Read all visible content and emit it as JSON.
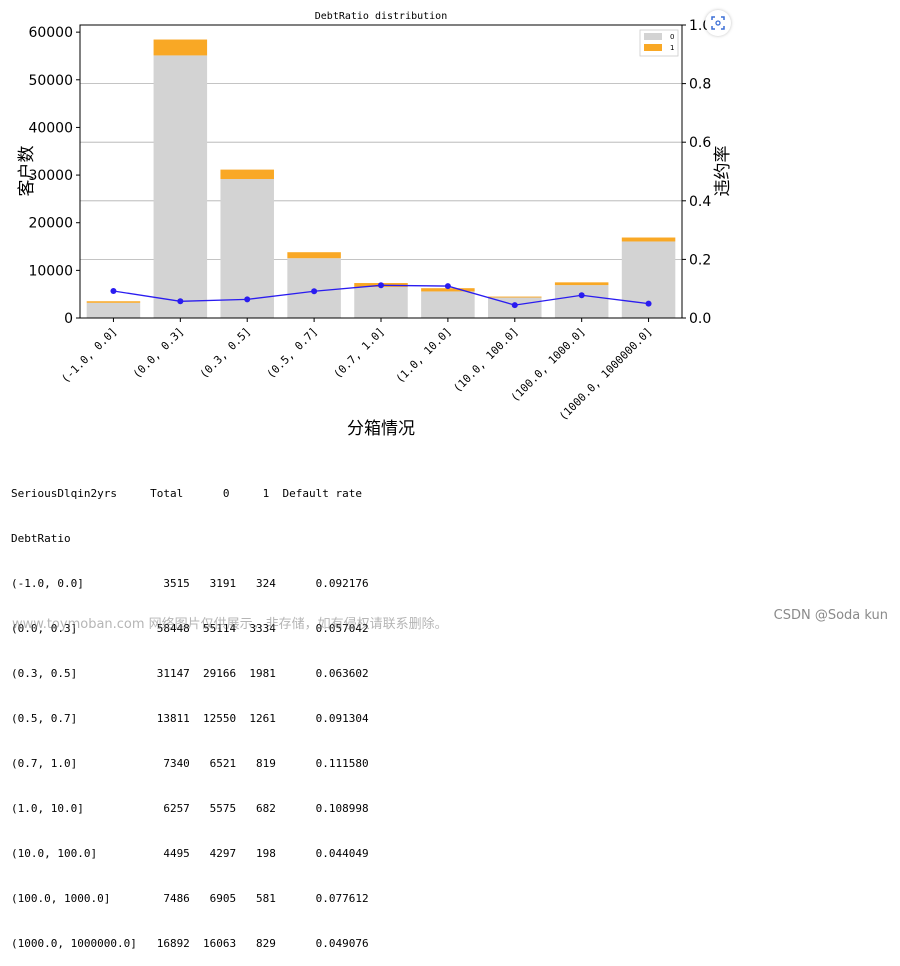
{
  "chart_data": {
    "type": "bar",
    "title": "DebtRatio distribution",
    "xlabel": "分箱情况",
    "ylabel": "客户数",
    "y2label": "违约率",
    "categories": [
      "(-1.0, 0.0]",
      "(0.0, 0.3]",
      "(0.3, 0.5]",
      "(0.5, 0.7]",
      "(0.7, 1.0]",
      "(1.0, 10.0]",
      "(10.0, 100.0]",
      "(100.0, 1000.0]",
      "(1000.0, 1000000.0]"
    ],
    "series": [
      {
        "name": "0",
        "values": [
          3191,
          55114,
          29166,
          12550,
          6521,
          5575,
          4297,
          6905,
          16063
        ],
        "color": "#d3d3d3",
        "stacked": true
      },
      {
        "name": "1",
        "values": [
          324,
          3334,
          1981,
          1261,
          819,
          682,
          198,
          581,
          829
        ],
        "color": "#f9a825",
        "stacked": true
      }
    ],
    "line_series": {
      "values": [
        0.092176,
        0.057042,
        0.063602,
        0.091304,
        0.11158,
        0.108998,
        0.044049,
        0.077612,
        0.049076
      ],
      "color": "#2a1cf0",
      "axis": "right"
    },
    "ylim": [
      0,
      61500
    ],
    "y2lim": [
      0,
      1.0
    ],
    "yticks": [
      "0",
      "10000",
      "20000",
      "30000",
      "40000",
      "50000",
      "60000"
    ],
    "y2ticks": [
      "0.0",
      "0.2",
      "0.4",
      "0.6",
      "0.8",
      "1.0"
    ],
    "legend": {
      "placement": "top-right",
      "entries": [
        "0",
        "1"
      ]
    },
    "grid": "horizontal, right axis"
  },
  "table": {
    "header1": "SeriousDlqin2yrs     Total      0     1  Default rate",
    "header2": "DebtRatio",
    "rows": [
      "(-1.0, 0.0]            3515   3191   324      0.092176",
      "(0.0, 0.3]            58448  55114  3334      0.057042",
      "(0.3, 0.5]            31147  29166  1981      0.063602",
      "(0.5, 0.7]            13811  12550  1261      0.091304",
      "(0.7, 1.0]             7340   6521   819      0.111580",
      "(1.0, 10.0]            6257   5575   682      0.108998",
      "(10.0, 100.0]          4495   4297   198      0.044049",
      "(100.0, 1000.0]        7486   6905   581      0.077612",
      "(1000.0, 1000000.0]   16892  16063   829      0.049076"
    ]
  },
  "watermark": {
    "left": "www.toymoban.com 网络图片仅供展示，非存储，如有侵权请联系删除。",
    "right": "CSDN @Soda kun"
  },
  "icons": {
    "scan": "scan-icon"
  }
}
